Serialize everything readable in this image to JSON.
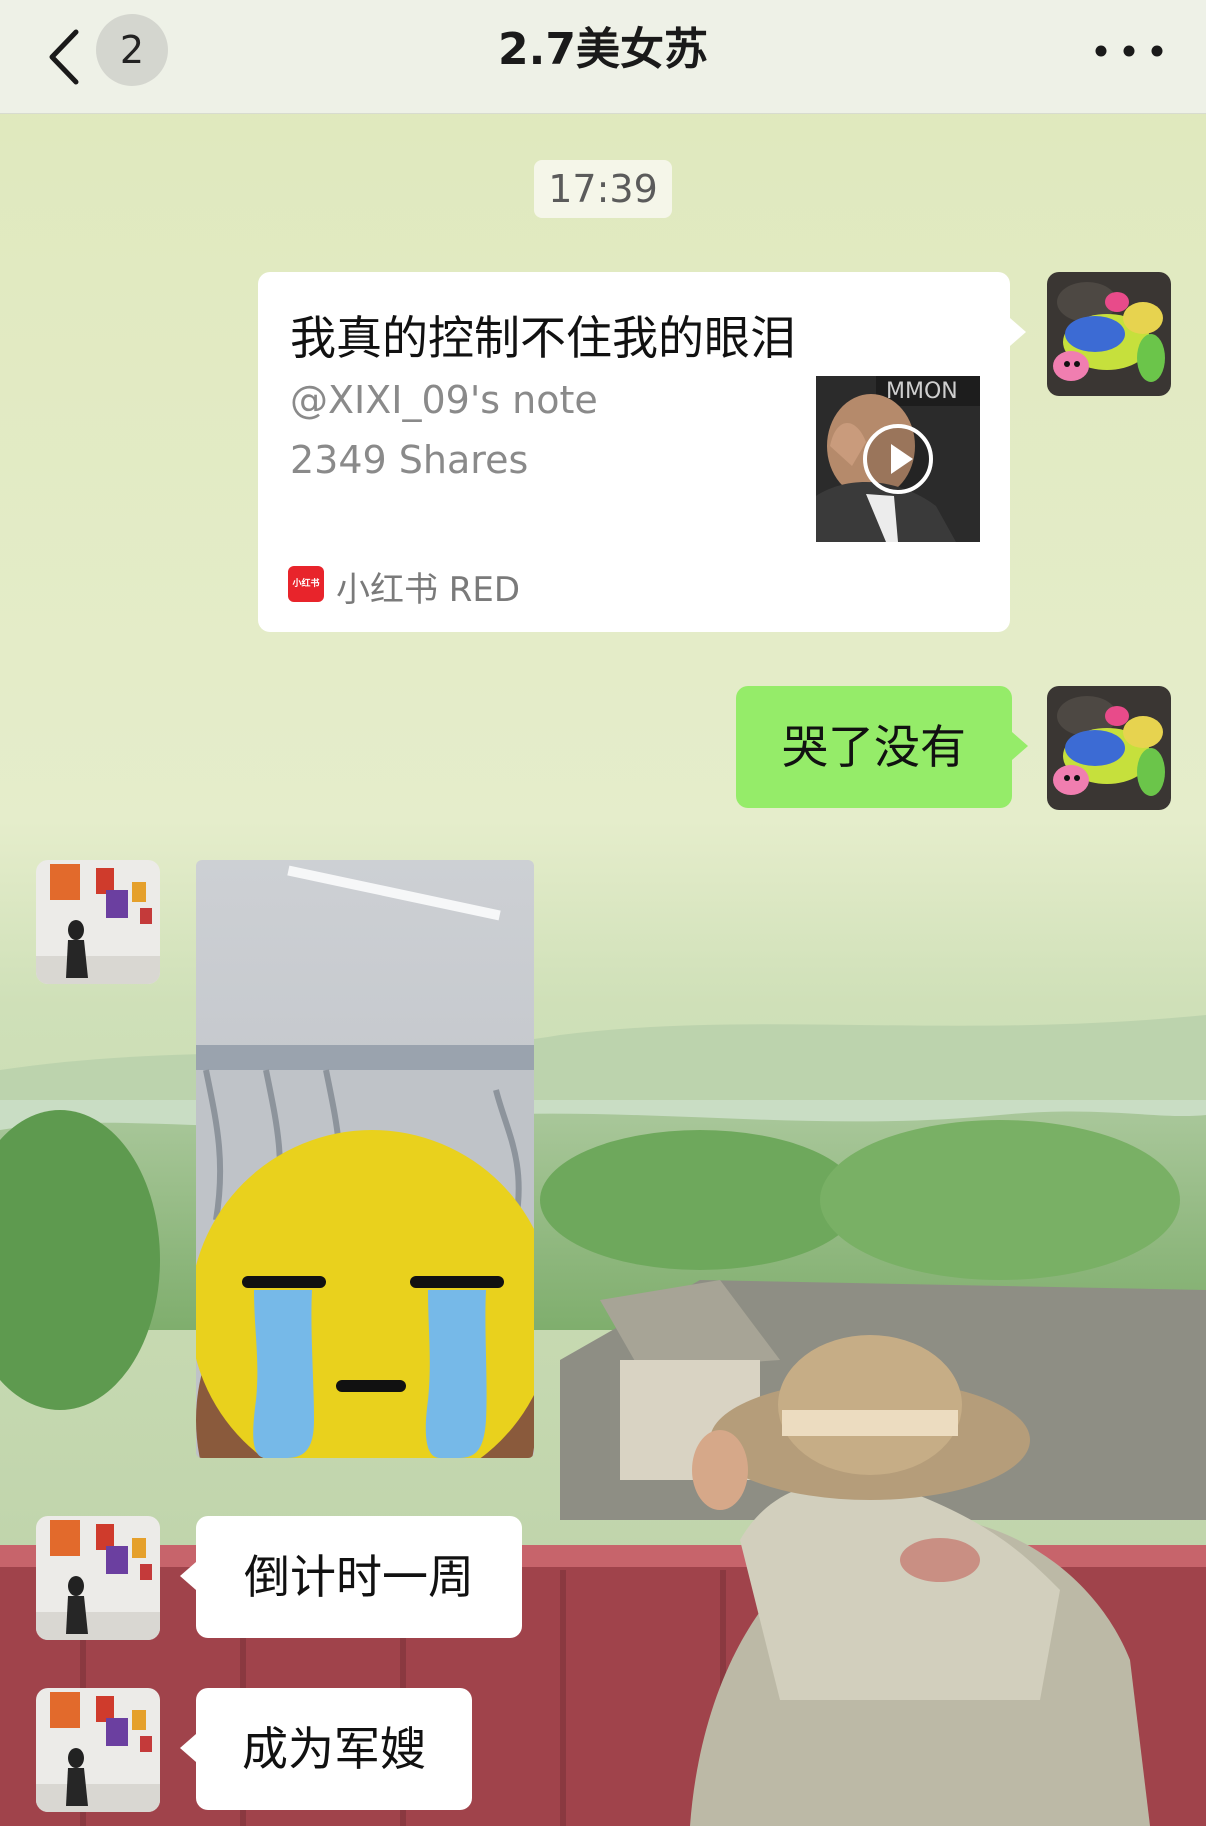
{
  "header": {
    "back_icon": "chevron-left-icon",
    "unread_count": "2",
    "title": "2.7美女苏",
    "more_icon": "ellipsis-icon"
  },
  "messages": {
    "timestamp": "17:39",
    "link_card": {
      "title": "我真的控制不住我的眼泪",
      "author": "@XIXI_09's note",
      "shares": "2349 Shares",
      "source_icon_text": "小红书",
      "source": "小红书 RED",
      "thumbnail_icon": "video-play-icon"
    },
    "sent_text": "哭了没有",
    "received_image_sticker": "crying-face-sticker",
    "received_texts": [
      "倒计时一周",
      "成为军嫂"
    ]
  },
  "colors": {
    "sent_bubble": "#95ec69",
    "received_bubble": "#ffffff",
    "header_bg": "#eef1e7",
    "red_brand": "#e8242b",
    "sticker_yellow": "#e9d11d",
    "tears_blue": "#76b9e8"
  }
}
